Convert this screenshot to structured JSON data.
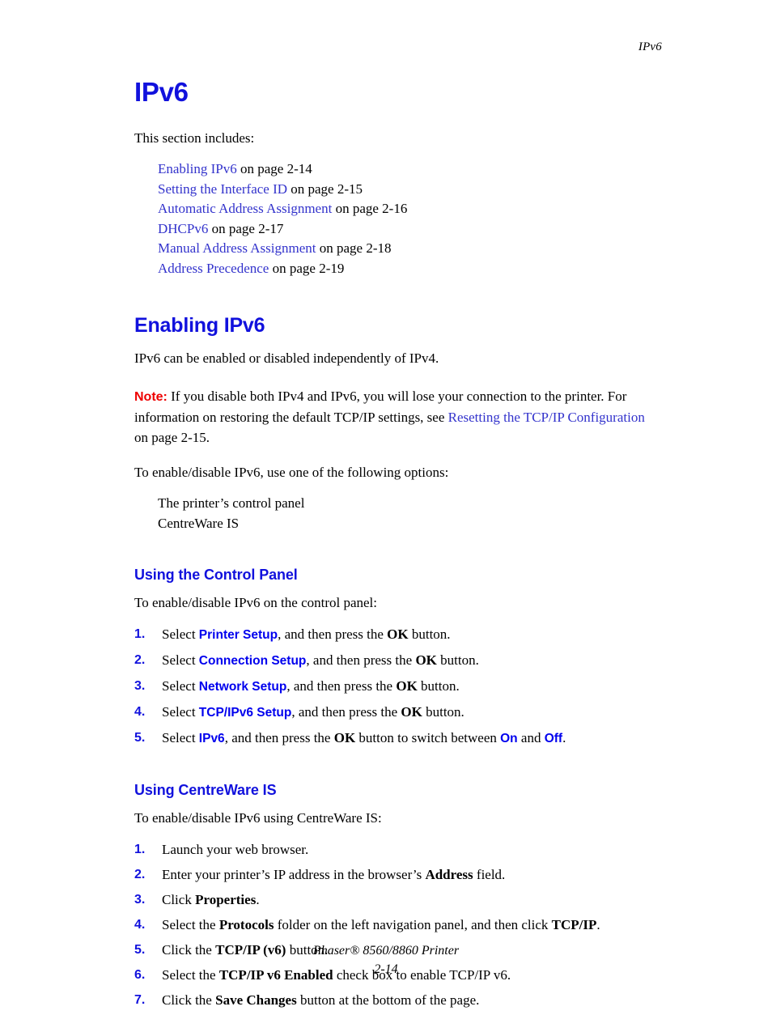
{
  "colors": {
    "heading_blue": "#1111DD",
    "link_blue": "#3333CC",
    "ui_term_blue": "#0000EE",
    "note_red": "#EE0000",
    "body_black": "#000000",
    "page_background": "#FFFFFF"
  },
  "running_header": {
    "text": "IPv6"
  },
  "page_title": "IPv6",
  "intro": {
    "lead": "This section includes:"
  },
  "section_links": [
    {
      "link": "Enabling IPv6",
      "suffix": " on page 2-14"
    },
    {
      "link": "Setting the Interface ID",
      "suffix": " on page 2-15"
    },
    {
      "link": "Automatic Address Assignment",
      "suffix": " on page 2-16"
    },
    {
      "link": "DHCPv6",
      "suffix": " on page 2-17"
    },
    {
      "link": "Manual Address Assignment",
      "suffix": " on page 2-18"
    },
    {
      "link": "Address Precedence",
      "suffix": " on page 2-19"
    }
  ],
  "enabling": {
    "heading": "Enabling IPv6",
    "intro": "IPv6 can be enabled or disabled independently of IPv4.",
    "note": {
      "label": "Note:",
      "text_before_link": " If you disable both IPv4 and IPv6, you will lose your connection to the printer. For information on restoring the default TCP/IP settings, see ",
      "link": "Resetting the TCP/IP Configuration",
      "text_after_link": " on page 2-15."
    },
    "options_lead": "To enable/disable IPv6, use one of the following options:",
    "options": [
      "The printer’s control panel",
      "CentreWare IS"
    ]
  },
  "control_panel": {
    "heading": "Using the Control Panel",
    "lead": "To enable/disable IPv6 on the control panel:",
    "steps": [
      {
        "num": "1.",
        "parts": [
          {
            "type": "text",
            "value": "Select "
          },
          {
            "type": "ui",
            "value": "Printer Setup"
          },
          {
            "type": "text",
            "value": ", and then press the "
          },
          {
            "type": "key",
            "value": "OK"
          },
          {
            "type": "text",
            "value": " button."
          }
        ]
      },
      {
        "num": "2.",
        "parts": [
          {
            "type": "text",
            "value": "Select "
          },
          {
            "type": "ui",
            "value": "Connection Setup"
          },
          {
            "type": "text",
            "value": ", and then press the "
          },
          {
            "type": "key",
            "value": "OK"
          },
          {
            "type": "text",
            "value": " button."
          }
        ]
      },
      {
        "num": "3.",
        "parts": [
          {
            "type": "text",
            "value": "Select "
          },
          {
            "type": "ui",
            "value": "Network Setup"
          },
          {
            "type": "text",
            "value": ", and then press the "
          },
          {
            "type": "key",
            "value": "OK"
          },
          {
            "type": "text",
            "value": " button."
          }
        ]
      },
      {
        "num": "4.",
        "parts": [
          {
            "type": "text",
            "value": "Select "
          },
          {
            "type": "ui",
            "value": "TCP/IPv6 Setup"
          },
          {
            "type": "text",
            "value": ", and then press the "
          },
          {
            "type": "key",
            "value": "OK"
          },
          {
            "type": "text",
            "value": " button."
          }
        ]
      },
      {
        "num": "5.",
        "parts": [
          {
            "type": "text",
            "value": "Select "
          },
          {
            "type": "ui",
            "value": "IPv6"
          },
          {
            "type": "text",
            "value": ", and then press the "
          },
          {
            "type": "key",
            "value": "OK"
          },
          {
            "type": "text",
            "value": " button to switch between "
          },
          {
            "type": "ui",
            "value": "On"
          },
          {
            "type": "text",
            "value": " and "
          },
          {
            "type": "ui",
            "value": "Off"
          },
          {
            "type": "text",
            "value": "."
          }
        ]
      }
    ]
  },
  "centreware": {
    "heading": "Using CentreWare IS",
    "lead": "To enable/disable IPv6 using CentreWare IS:",
    "steps": [
      {
        "num": "1.",
        "parts": [
          {
            "type": "text",
            "value": "Launch your web browser."
          }
        ]
      },
      {
        "num": "2.",
        "parts": [
          {
            "type": "text",
            "value": "Enter your printer’s IP address in the browser’s "
          },
          {
            "type": "bold",
            "value": "Address"
          },
          {
            "type": "text",
            "value": " field."
          }
        ]
      },
      {
        "num": "3.",
        "parts": [
          {
            "type": "text",
            "value": "Click "
          },
          {
            "type": "bold",
            "value": "Properties"
          },
          {
            "type": "text",
            "value": "."
          }
        ]
      },
      {
        "num": "4.",
        "parts": [
          {
            "type": "text",
            "value": "Select the "
          },
          {
            "type": "bold",
            "value": "Protocols"
          },
          {
            "type": "text",
            "value": " folder on the left navigation panel, and then click "
          },
          {
            "type": "bold",
            "value": "TCP/IP"
          },
          {
            "type": "text",
            "value": "."
          }
        ]
      },
      {
        "num": "5.",
        "parts": [
          {
            "type": "text",
            "value": "Click the "
          },
          {
            "type": "bold",
            "value": "TCP/IP (v6)"
          },
          {
            "type": "text",
            "value": " button."
          }
        ]
      },
      {
        "num": "6.",
        "parts": [
          {
            "type": "text",
            "value": "Select the "
          },
          {
            "type": "bold",
            "value": "TCP/IP v6 Enabled"
          },
          {
            "type": "text",
            "value": " check box to enable TCP/IP v6."
          }
        ]
      },
      {
        "num": "7.",
        "parts": [
          {
            "type": "text",
            "value": "Click the "
          },
          {
            "type": "bold",
            "value": "Save Changes"
          },
          {
            "type": "text",
            "value": " button at the bottom of the page."
          }
        ]
      }
    ]
  },
  "footer": {
    "product": "Phaser® 8560/8860 Printer",
    "page_number": "2-14"
  }
}
